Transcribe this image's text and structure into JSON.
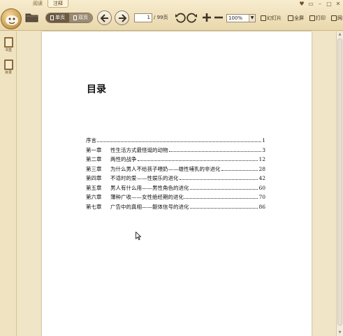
{
  "tabs": [
    {
      "label": "阅读",
      "active": false
    },
    {
      "label": "注释",
      "active": true
    }
  ],
  "window_controls": [
    "♥",
    "▭",
    "–",
    "□",
    "✕"
  ],
  "view_mode": {
    "single": "单页",
    "double": "双页"
  },
  "page_nav": {
    "current": "1",
    "total": "/ 99页"
  },
  "zoom": {
    "value": "100%"
  },
  "toolbar_buttons": {
    "slideshow": "幻灯片",
    "fullscreen": "全屏",
    "print": "打印",
    "more": "网"
  },
  "sidebar": {
    "bookmarks": "书签",
    "toc": "目录"
  },
  "document": {
    "title": "目录",
    "toc": [
      {
        "chapter": "",
        "title": "序言",
        "page": "1"
      },
      {
        "chapter": "第一章",
        "title": "性生活方式最怪诞的动物",
        "page": "3"
      },
      {
        "chapter": "第二章",
        "title": "两性的战争",
        "page": "12"
      },
      {
        "chapter": "第三章",
        "title": "为什么男人不给孩子喂奶——雄性哺乳的非进化",
        "page": "28"
      },
      {
        "chapter": "第四章",
        "title": "不适时的爱——性娱乐的进化",
        "page": "42"
      },
      {
        "chapter": "第五章",
        "title": "男人有什么用——男性角色的进化",
        "page": "60"
      },
      {
        "chapter": "第六章",
        "title": "薄种广收——女性绝经期的进化",
        "page": "70"
      },
      {
        "chapter": "第七章",
        "title": "广告中的真相——躯体信号的进化",
        "page": "86"
      }
    ]
  },
  "colors": {
    "chrome": "#efe3c2",
    "accent": "#8b6a36",
    "page": "#ffffff"
  }
}
